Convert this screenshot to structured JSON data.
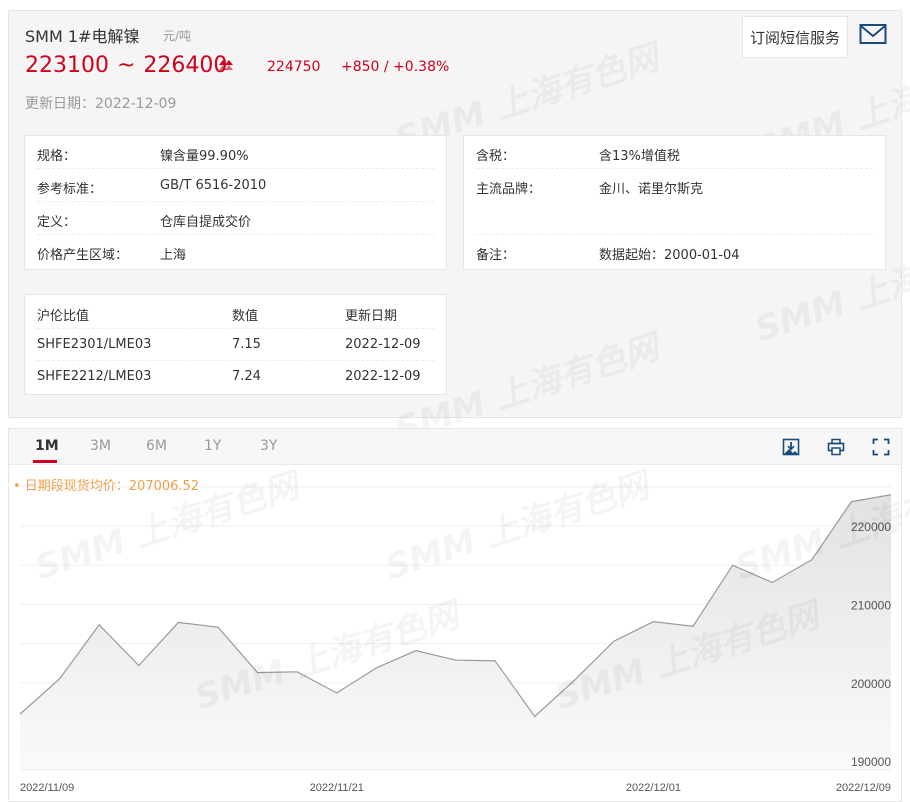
{
  "header": {
    "title": "SMM 1#电解镍",
    "unit": "元/吨",
    "subscribe_label": "订阅短信服务",
    "price_low": "223100",
    "tilde": "~",
    "price_high": "226400",
    "avg_price": "224750",
    "change": "+850  /  +0.38%",
    "update_date": "更新日期：2022-12-09"
  },
  "specs_left": [
    {
      "key": "规格：",
      "value": "镍含量99.90%"
    },
    {
      "key": "参考标准：",
      "value": "GB/T 6516-2010"
    },
    {
      "key": "定义：",
      "value": "仓库自提成交价"
    },
    {
      "key": "价格产生区域：",
      "value": "上海"
    }
  ],
  "specs_right": [
    {
      "key": "含税：",
      "value": "含13%增值税"
    },
    {
      "key": "主流品牌：",
      "value": "金川、诺里尔斯克"
    },
    {
      "key": "备注：",
      "value": "数据起始：2000-01-04"
    }
  ],
  "ratio_table": {
    "headers": [
      "沪伦比值",
      "数值",
      "更新日期"
    ],
    "rows": [
      [
        "SHFE2301/LME03",
        "7.15",
        "2022-12-09"
      ],
      [
        "SHFE2212/LME03",
        "7.24",
        "2022-12-09"
      ]
    ]
  },
  "tabs": [
    "1M",
    "3M",
    "6M",
    "1Y",
    "3Y"
  ],
  "active_tab": "1M",
  "watermark_text": "SMM 上海有色网",
  "avg_label": "• 日期段现货均价：207006.52",
  "colors": {
    "accent_red": "#d0021b",
    "line": "#999999",
    "fill": "#ececec",
    "avg_label": "#f0a04b",
    "icon_blue": "#1a4a7a"
  },
  "chart_data": {
    "type": "area",
    "x": [
      "2022/11/09",
      "2022/11/10",
      "2022/11/11",
      "2022/11/14",
      "2022/11/15",
      "2022/11/16",
      "2022/11/17",
      "2022/11/18",
      "2022/11/21",
      "2022/11/22",
      "2022/11/23",
      "2022/11/24",
      "2022/11/25",
      "2022/11/28",
      "2022/11/29",
      "2022/11/30",
      "2022/12/01",
      "2022/12/02",
      "2022/12/05",
      "2022/12/06",
      "2022/12/07",
      "2022/12/08",
      "2022/12/09"
    ],
    "values": [
      196000,
      200500,
      207400,
      202200,
      207700,
      207100,
      201300,
      201400,
      198700,
      201900,
      204100,
      202900,
      202800,
      195700,
      200300,
      205300,
      207800,
      207200,
      215000,
      212800,
      215700,
      223100,
      224000
    ],
    "x_tick_labels": [
      "2022/11/09",
      "2022/11/21",
      "2022/12/01",
      "2022/12/09"
    ],
    "y_ticks": [
      190000,
      200000,
      210000,
      220000
    ],
    "ylim": [
      189000,
      226000
    ],
    "grid": true
  }
}
